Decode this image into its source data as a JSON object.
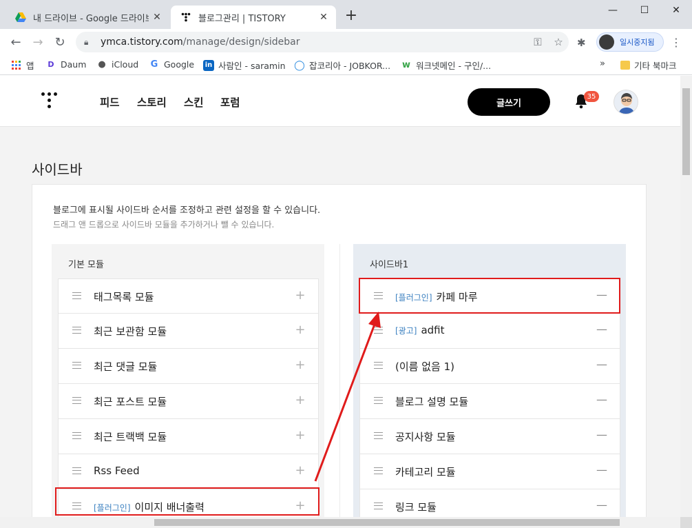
{
  "browser": {
    "tabs": [
      {
        "title": "내 드라이브 - Google 드라이브",
        "active": false
      },
      {
        "title": "블로그관리 | TISTORY",
        "active": true
      }
    ],
    "window_controls": {
      "minimize": "—",
      "maximize": "☐",
      "close": "✕"
    },
    "url_host": "ymca.tistory.com",
    "url_path": "/manage/design/sidebar",
    "profile_label": "일시중지됨",
    "bookmarks": [
      {
        "label": "앱",
        "icon": "apps-grid-icon"
      },
      {
        "label": "Daum",
        "icon": "daum-icon"
      },
      {
        "label": "iCloud",
        "icon": "apple-icon"
      },
      {
        "label": "Google",
        "icon": "google-icon"
      },
      {
        "label": "사람인 - saramin",
        "icon": "linkedin-icon"
      },
      {
        "label": "잡코리아 - JOBKOR...",
        "icon": "jobkorea-icon"
      },
      {
        "label": "워크넷메인 - 구인/...",
        "icon": "worknet-icon"
      }
    ],
    "bookmarks_overflow": "»",
    "other_bookmarks": "기타 북마크"
  },
  "site": {
    "nav": [
      "피드",
      "스토리",
      "스킨",
      "포럼"
    ],
    "write_button": "글쓰기",
    "notification_count": "35"
  },
  "page": {
    "title": "사이드바",
    "desc_main": "블로그에 표시될 사이드바 순서를 조정하고 관련 설정을 할 수 있습니다.",
    "desc_sub": "드래그 앤 드롭으로 사이드바 모듈을 추가하거나 뺄 수 있습니다."
  },
  "left_panel": {
    "header": "기본 모듈",
    "items": [
      {
        "tag": "",
        "label": "태그목록 모듈"
      },
      {
        "tag": "",
        "label": "최근 보관함 모듈"
      },
      {
        "tag": "",
        "label": "최근 댓글 모듈"
      },
      {
        "tag": "",
        "label": "최근 포스트 모듈"
      },
      {
        "tag": "",
        "label": "최근 트랙백 모듈"
      },
      {
        "tag": "",
        "label": "Rss Feed"
      },
      {
        "tag": "[플러그인]",
        "label": "이미지 배너출력"
      }
    ],
    "action_symbol": "+"
  },
  "right_panel": {
    "header": "사이드바1",
    "items": [
      {
        "tag": "[플러그인]",
        "label": "카페 마루"
      },
      {
        "tag": "[광고]",
        "label": "adfit"
      },
      {
        "tag": "",
        "label": "(이름 없음 1)"
      },
      {
        "tag": "",
        "label": "블로그 설명 모듈"
      },
      {
        "tag": "",
        "label": "공지사항 모듈"
      },
      {
        "tag": "",
        "label": "카테고리 모듈"
      },
      {
        "tag": "",
        "label": "링크 모듈"
      }
    ],
    "action_symbol": "—"
  },
  "colors": {
    "annotation_red": "#e01b1b",
    "tag_blue": "#3b80c0",
    "badge_red": "#f0553f"
  }
}
